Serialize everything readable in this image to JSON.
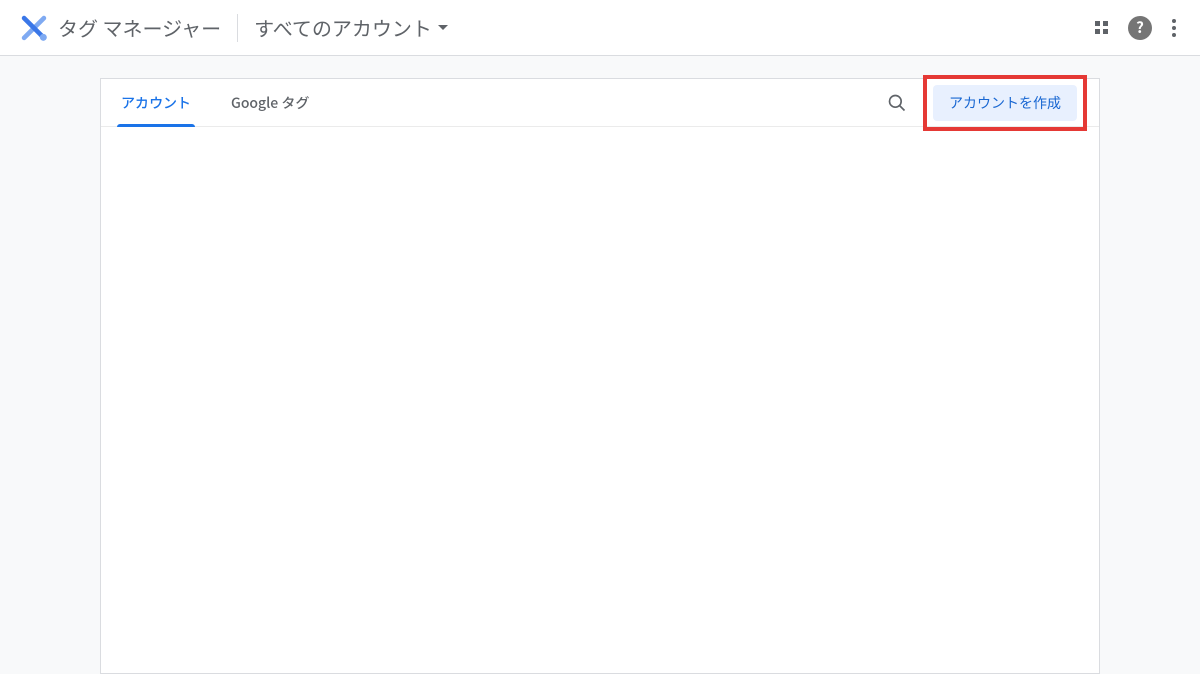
{
  "header": {
    "product_name": "タグ マネージャー",
    "account_selector": "すべてのアカウント"
  },
  "tabs": [
    {
      "label": "アカウント",
      "active": true
    },
    {
      "label": "Google タグ",
      "active": false
    }
  ],
  "actions": {
    "create_account": "アカウントを作成"
  }
}
